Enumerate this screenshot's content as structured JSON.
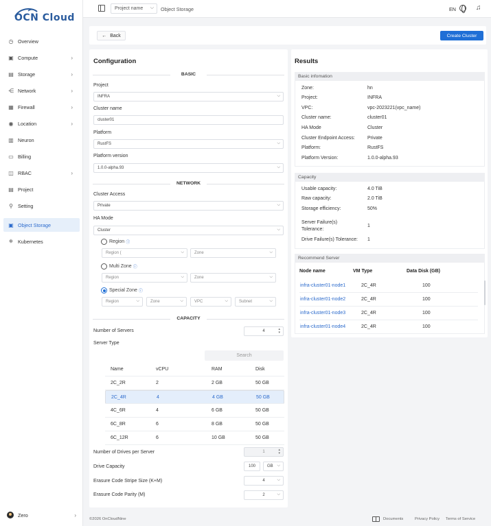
{
  "brand": {
    "logo_text": "OCN Cloud",
    "accent": "#1f6fd6"
  },
  "sidebar": {
    "items": [
      {
        "label": "Overview",
        "icon": "dashboard-icon",
        "chevron": false
      },
      {
        "label": "Compute",
        "icon": "cpu-icon",
        "chevron": true
      },
      {
        "label": "Storage",
        "icon": "storage-icon",
        "chevron": true
      },
      {
        "label": "Network",
        "icon": "network-icon",
        "chevron": true
      },
      {
        "label": "Firewall",
        "icon": "firewall-icon",
        "chevron": true
      },
      {
        "label": "Location",
        "icon": "location-icon",
        "chevron": true
      },
      {
        "label": "Neuron",
        "icon": "server-icon",
        "chevron": false
      },
      {
        "label": "Billing",
        "icon": "billing-icon",
        "chevron": false
      },
      {
        "label": "RBAC",
        "icon": "rbac-icon",
        "chevron": true
      },
      {
        "label": "Project",
        "icon": "project-icon",
        "chevron": false
      },
      {
        "label": "Setting",
        "icon": "wrench-icon",
        "chevron": false
      },
      {
        "label": "Object Storage",
        "icon": "object-storage-icon",
        "chevron": false,
        "active": true
      },
      {
        "label": "Kubernetes",
        "icon": "kubernetes-icon",
        "chevron": false
      }
    ],
    "user": {
      "name": "Zero"
    }
  },
  "topbar": {
    "project_placeholder": "Project name",
    "breadcrumb": "Object Storage",
    "language": "EN"
  },
  "actions": {
    "back": "Back",
    "create": "Create Cluster"
  },
  "config": {
    "title": "Configuration",
    "sections": {
      "basic": "BASIC",
      "network": "NETWORK",
      "capacity": "CAPACITY"
    },
    "project": {
      "label": "Project",
      "value": "INFRA"
    },
    "cluster_name": {
      "label": "Cluster name",
      "value": "cluster01"
    },
    "platform": {
      "label": "Platform",
      "value": "RustFS"
    },
    "platform_version": {
      "label": "Platform version",
      "value": "1.0.0-alpha.93"
    },
    "cluster_access": {
      "label": "Cluster Access",
      "value": "Private"
    },
    "ha_mode": {
      "label": "HA Mode",
      "value": "Cluster"
    },
    "region_option": {
      "label": "Region",
      "region_select": "Region (",
      "zone_select": "Zone"
    },
    "multi_zone_option": {
      "label": "Multi Zone",
      "region_select": "Region",
      "zone_select": "Zone"
    },
    "special_zone_option": {
      "label": "Special Zone",
      "region_select": "Region",
      "zone_select": "Zone",
      "vpc_select": "VPC",
      "subnet_select": "Subnet"
    },
    "info_glyph": "ⓘ",
    "num_servers": {
      "label": "Number of Servers",
      "value": "4"
    },
    "server_type": {
      "label": "Server Type",
      "search_placeholder": "Search",
      "columns": [
        "Name",
        "vCPU",
        "RAM",
        "Disk"
      ],
      "rows": [
        [
          "2C_2R",
          "2",
          "2 GB",
          "50 GB"
        ],
        [
          "2C_4R",
          "4",
          "4 GB",
          "50 GB"
        ],
        [
          "4C_6R",
          "4",
          "6 GB",
          "50 GB"
        ],
        [
          "6C_8R",
          "6",
          "8 GB",
          "50 GB"
        ],
        [
          "6C_12R",
          "6",
          "10 GB",
          "50 GB"
        ]
      ],
      "selected_index": 1
    },
    "drives_per_server": {
      "label": "Number of Drives per Server",
      "value": "1"
    },
    "drive_capacity": {
      "label": "Drive Capacity",
      "value": "100",
      "unit": "GB"
    },
    "stripe_size": {
      "label": "Erasure Code Stripe Size (K+M)",
      "value": "4"
    },
    "parity": {
      "label": "Erasure Code Parity (M)",
      "value": "2"
    }
  },
  "results": {
    "title": "Results",
    "basic": {
      "header": "Basic infomation",
      "items": [
        {
          "k": "Zone:",
          "v": "hn"
        },
        {
          "k": "Project:",
          "v": "INFRA"
        },
        {
          "k": "VPC:",
          "v": "vpc-2023221(vpc_name)"
        },
        {
          "k": "Cluster name:",
          "v": "cluster01"
        },
        {
          "k": "HA Mode",
          "v": "Cluster"
        },
        {
          "k": "Cluster Endpoint Access:",
          "v": "Private"
        },
        {
          "k": "Platform:",
          "v": "RustFS"
        },
        {
          "k": "Platform Version:",
          "v": "1.0.0-alpha.93"
        }
      ]
    },
    "capacity": {
      "header": "Capacity",
      "usable_k": "Usable capacity:",
      "usable_v": "4.0 TiB",
      "raw_k": "Raw capacity:",
      "raw_v": "2.0 TiB",
      "eff_k": "Storage efficiency:",
      "eff_v": "50%",
      "sft_k1": "Server Failure(s)",
      "sft_k2": "Tolerance:",
      "sft_v": "1",
      "dft_k": "Drive Failure(s) Tolerance:",
      "dft_v": "1"
    },
    "recommend": {
      "header": "Recommend Server",
      "columns": [
        "Node name",
        "VM Type",
        "Data Disk (GB)"
      ],
      "rows": [
        [
          "infra-cluster01-node1",
          "2C_4R",
          "100"
        ],
        [
          "infra-cluster01-node2",
          "2C_4R",
          "100"
        ],
        [
          "infra-cluster01-node3",
          "2C_4R",
          "100"
        ],
        [
          "infra-cluster01-node4",
          "2C_4R",
          "100"
        ]
      ]
    }
  },
  "footer": {
    "copyright": "©2026 OnCloudNine",
    "documents": "Documents",
    "privacy": "Privacy Policy",
    "terms": "Terms of Service"
  }
}
